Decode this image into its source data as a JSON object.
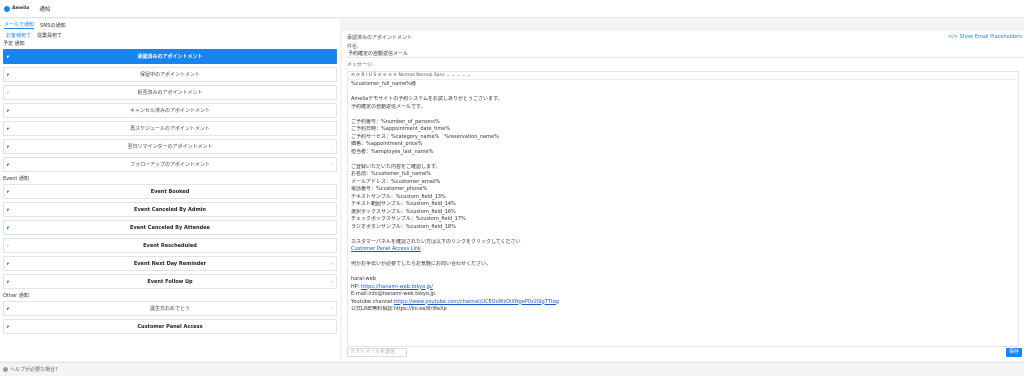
{
  "app": {
    "logo": "Amelia",
    "title": "通知"
  },
  "tabs": [
    {
      "label": "メールで通知",
      "active": true
    },
    {
      "label": "SMSの通知",
      "active": false
    }
  ],
  "subtabs": [
    {
      "label": "お客様宛て",
      "active": true
    },
    {
      "label": "従業員宛て",
      "active": false
    }
  ],
  "sections": {
    "appointment": "予定 通知",
    "event": "Event 通知",
    "other": "Other 通知"
  },
  "appointment_items": [
    {
      "label": "承認済みのアポイントメント",
      "selected": true,
      "enabled": true,
      "chevron": false
    },
    {
      "label": "保留中のアポイントメント",
      "selected": false,
      "enabled": true,
      "chevron": false
    },
    {
      "label": "拒否済みのアポイントメント",
      "selected": false,
      "enabled": false,
      "chevron": false
    },
    {
      "label": "キャンセル済みのアポイントメント",
      "selected": false,
      "enabled": true,
      "chevron": false
    },
    {
      "label": "再スケジュールのアポイントメント",
      "selected": false,
      "enabled": true,
      "chevron": false
    },
    {
      "label": "翌日リマインダーのアポイントメント",
      "selected": false,
      "enabled": true,
      "chevron": true
    },
    {
      "label": "フォローアップのアポイントメント",
      "selected": false,
      "enabled": true,
      "chevron": true
    }
  ],
  "event_items": [
    {
      "label": "Event Booked",
      "enabled": true,
      "chevron": false
    },
    {
      "label": "Event Canceled By Admin",
      "enabled": true,
      "chevron": false
    },
    {
      "label": "Event Canceled By Attendee",
      "enabled": true,
      "chevron": false
    },
    {
      "label": "Event Rescheduled",
      "enabled": false,
      "chevron": false
    },
    {
      "label": "Event Next Day Reminder",
      "enabled": true,
      "chevron": true
    },
    {
      "label": "Event Follow Up",
      "enabled": true,
      "chevron": true
    }
  ],
  "other_items": [
    {
      "label": "誕生日おめでとう",
      "enabled": true,
      "chevron": true
    },
    {
      "label": "Customer Panel Access",
      "enabled": true,
      "chevron": false
    }
  ],
  "editor": {
    "heading": "承認済みのアポイントメント",
    "placeholders_link": "</> Show Email Placeholders",
    "name_label": "件名:",
    "name_value": "予約確定の自動返信メール",
    "message_label": "メッセージ:",
    "toolbar": "⟲ ⟳  B  I  U  S  ≡  ≡  ≡  ≡   Normal  Normal  Sans ⌄  ⌄ ⌄  ⌄  ⌄",
    "lines": [
      "%customer_full_name%様",
      "",
      "Ameliaデモサイトの予約システムをお試しありがとうございます。",
      "予約確定の自動返信メールです。",
      "",
      "ご予約番号：%number_of_persons%",
      "ご予約日時：%appointment_date_time%",
      "ご予約サービス：%category_name%　%reservation_name%",
      "価格：%appointment_price%",
      "担当者：%employee_last_name%",
      "",
      "ご登録いただいた内容をご確認します。",
      "お名前：%customer_full_name%",
      "メールアドレス：%customer_email%",
      "電話番号：%customer_phone%",
      "テキストサンプル：%custom_field_13%",
      "テキスト範囲サンプル：%custom_field_14%",
      "選択ボックスサンプル：%custom_field_16%",
      "チェックボックスサンプル：%custom_field_17%",
      "ラジオボタンサンプル：%custom_field_18%",
      "",
      "カスタマーパネルを確認されたい方は以下のリンクをクリックしてください",
      "",
      "",
      "何かお手伝いが必要でしたらお気軽にお問い合わせください。",
      "",
      "harai-web",
      "",
      "",
      "",
      ""
    ],
    "link_line_21": "Customer Panel Access Link",
    "hp_prefix": "HP: ",
    "hp_url": "https://hanami-web.tokyo.jp/",
    "email_line": "E-mail:info@hanami-web.tokyo.jp",
    "youtube_prefix": "Youtube channel:",
    "youtube_url": "https://www.youtube.com/channel/UCEOoWzDlXNgeP0z2i9g7Ttag",
    "line_line": "公式LINE無料相談:https://lin.ee/8rl8eXp",
    "test_button": "テストメールを送信",
    "save_button": "保存"
  },
  "footer": {
    "help": "ヘルプが必要な場合?"
  }
}
